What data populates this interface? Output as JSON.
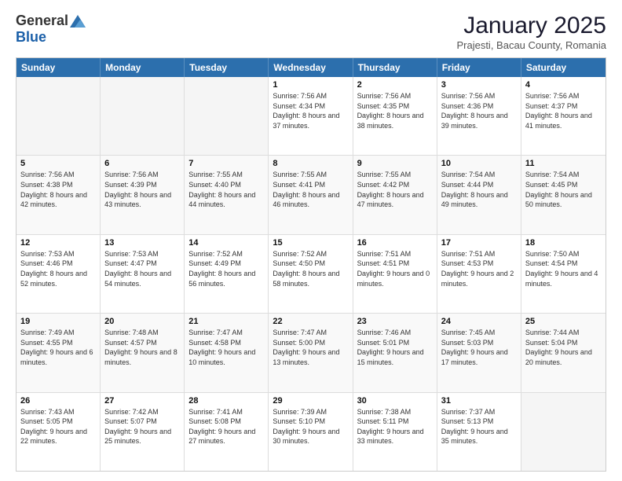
{
  "logo": {
    "general": "General",
    "blue": "Blue"
  },
  "header": {
    "title": "January 2025",
    "location": "Prajesti, Bacau County, Romania"
  },
  "days": [
    "Sunday",
    "Monday",
    "Tuesday",
    "Wednesday",
    "Thursday",
    "Friday",
    "Saturday"
  ],
  "weeks": [
    [
      {
        "day": "",
        "content": ""
      },
      {
        "day": "",
        "content": ""
      },
      {
        "day": "",
        "content": ""
      },
      {
        "day": "1",
        "content": "Sunrise: 7:56 AM\nSunset: 4:34 PM\nDaylight: 8 hours and 37 minutes."
      },
      {
        "day": "2",
        "content": "Sunrise: 7:56 AM\nSunset: 4:35 PM\nDaylight: 8 hours and 38 minutes."
      },
      {
        "day": "3",
        "content": "Sunrise: 7:56 AM\nSunset: 4:36 PM\nDaylight: 8 hours and 39 minutes."
      },
      {
        "day": "4",
        "content": "Sunrise: 7:56 AM\nSunset: 4:37 PM\nDaylight: 8 hours and 41 minutes."
      }
    ],
    [
      {
        "day": "5",
        "content": "Sunrise: 7:56 AM\nSunset: 4:38 PM\nDaylight: 8 hours and 42 minutes."
      },
      {
        "day": "6",
        "content": "Sunrise: 7:56 AM\nSunset: 4:39 PM\nDaylight: 8 hours and 43 minutes."
      },
      {
        "day": "7",
        "content": "Sunrise: 7:55 AM\nSunset: 4:40 PM\nDaylight: 8 hours and 44 minutes."
      },
      {
        "day": "8",
        "content": "Sunrise: 7:55 AM\nSunset: 4:41 PM\nDaylight: 8 hours and 46 minutes."
      },
      {
        "day": "9",
        "content": "Sunrise: 7:55 AM\nSunset: 4:42 PM\nDaylight: 8 hours and 47 minutes."
      },
      {
        "day": "10",
        "content": "Sunrise: 7:54 AM\nSunset: 4:44 PM\nDaylight: 8 hours and 49 minutes."
      },
      {
        "day": "11",
        "content": "Sunrise: 7:54 AM\nSunset: 4:45 PM\nDaylight: 8 hours and 50 minutes."
      }
    ],
    [
      {
        "day": "12",
        "content": "Sunrise: 7:53 AM\nSunset: 4:46 PM\nDaylight: 8 hours and 52 minutes."
      },
      {
        "day": "13",
        "content": "Sunrise: 7:53 AM\nSunset: 4:47 PM\nDaylight: 8 hours and 54 minutes."
      },
      {
        "day": "14",
        "content": "Sunrise: 7:52 AM\nSunset: 4:49 PM\nDaylight: 8 hours and 56 minutes."
      },
      {
        "day": "15",
        "content": "Sunrise: 7:52 AM\nSunset: 4:50 PM\nDaylight: 8 hours and 58 minutes."
      },
      {
        "day": "16",
        "content": "Sunrise: 7:51 AM\nSunset: 4:51 PM\nDaylight: 9 hours and 0 minutes."
      },
      {
        "day": "17",
        "content": "Sunrise: 7:51 AM\nSunset: 4:53 PM\nDaylight: 9 hours and 2 minutes."
      },
      {
        "day": "18",
        "content": "Sunrise: 7:50 AM\nSunset: 4:54 PM\nDaylight: 9 hours and 4 minutes."
      }
    ],
    [
      {
        "day": "19",
        "content": "Sunrise: 7:49 AM\nSunset: 4:55 PM\nDaylight: 9 hours and 6 minutes."
      },
      {
        "day": "20",
        "content": "Sunrise: 7:48 AM\nSunset: 4:57 PM\nDaylight: 9 hours and 8 minutes."
      },
      {
        "day": "21",
        "content": "Sunrise: 7:47 AM\nSunset: 4:58 PM\nDaylight: 9 hours and 10 minutes."
      },
      {
        "day": "22",
        "content": "Sunrise: 7:47 AM\nSunset: 5:00 PM\nDaylight: 9 hours and 13 minutes."
      },
      {
        "day": "23",
        "content": "Sunrise: 7:46 AM\nSunset: 5:01 PM\nDaylight: 9 hours and 15 minutes."
      },
      {
        "day": "24",
        "content": "Sunrise: 7:45 AM\nSunset: 5:03 PM\nDaylight: 9 hours and 17 minutes."
      },
      {
        "day": "25",
        "content": "Sunrise: 7:44 AM\nSunset: 5:04 PM\nDaylight: 9 hours and 20 minutes."
      }
    ],
    [
      {
        "day": "26",
        "content": "Sunrise: 7:43 AM\nSunset: 5:05 PM\nDaylight: 9 hours and 22 minutes."
      },
      {
        "day": "27",
        "content": "Sunrise: 7:42 AM\nSunset: 5:07 PM\nDaylight: 9 hours and 25 minutes."
      },
      {
        "day": "28",
        "content": "Sunrise: 7:41 AM\nSunset: 5:08 PM\nDaylight: 9 hours and 27 minutes."
      },
      {
        "day": "29",
        "content": "Sunrise: 7:39 AM\nSunset: 5:10 PM\nDaylight: 9 hours and 30 minutes."
      },
      {
        "day": "30",
        "content": "Sunrise: 7:38 AM\nSunset: 5:11 PM\nDaylight: 9 hours and 33 minutes."
      },
      {
        "day": "31",
        "content": "Sunrise: 7:37 AM\nSunset: 5:13 PM\nDaylight: 9 hours and 35 minutes."
      },
      {
        "day": "",
        "content": ""
      }
    ]
  ]
}
